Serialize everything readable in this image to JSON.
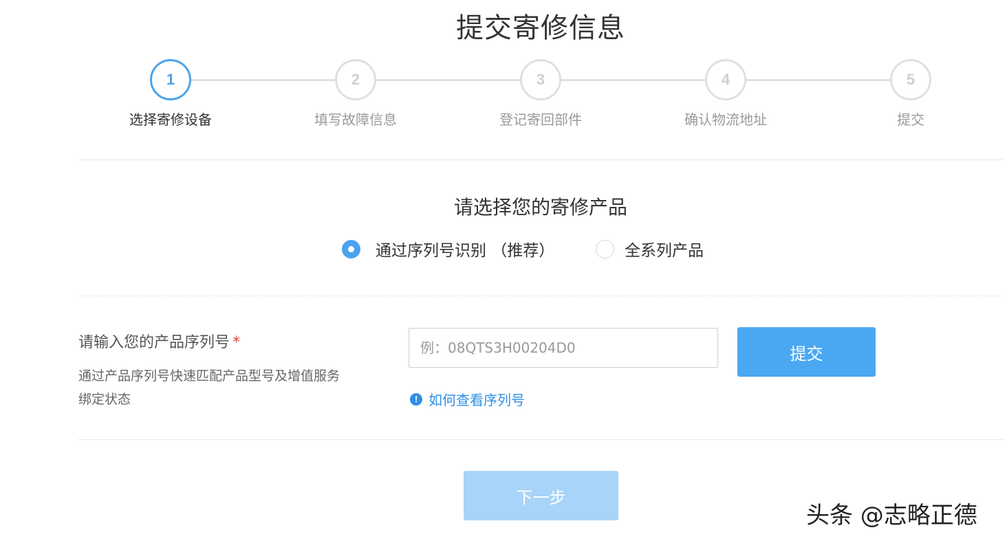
{
  "page": {
    "title": "提交寄修信息"
  },
  "stepper": {
    "steps": [
      {
        "number": "1",
        "label": "选择寄修设备",
        "active": true
      },
      {
        "number": "2",
        "label": "填写故障信息",
        "active": false
      },
      {
        "number": "3",
        "label": "登记寄回部件",
        "active": false
      },
      {
        "number": "4",
        "label": "确认物流地址",
        "active": false
      },
      {
        "number": "5",
        "label": "提交",
        "active": false
      }
    ]
  },
  "product_select": {
    "title": "请选择您的寄修产品",
    "options": [
      {
        "label": "通过序列号识别 （推荐）",
        "checked": true
      },
      {
        "label": "全系列产品",
        "checked": false
      }
    ]
  },
  "serial": {
    "label": "请输入您的产品序列号",
    "required_mark": "*",
    "description": "通过产品序列号快速匹配产品型号及增值服务绑定状态",
    "placeholder": "例：08QTS3H00204D0",
    "value": "",
    "submit_label": "提交",
    "help_icon_glyph": "!",
    "help_link": "如何查看序列号"
  },
  "footer": {
    "next_label": "下一步"
  },
  "watermark": {
    "text": "头条 @志略正德"
  },
  "colors": {
    "accent": "#4aa3ee",
    "link": "#2f8fe6",
    "disabled": "#a7d4f8",
    "required": "#e0453d"
  }
}
